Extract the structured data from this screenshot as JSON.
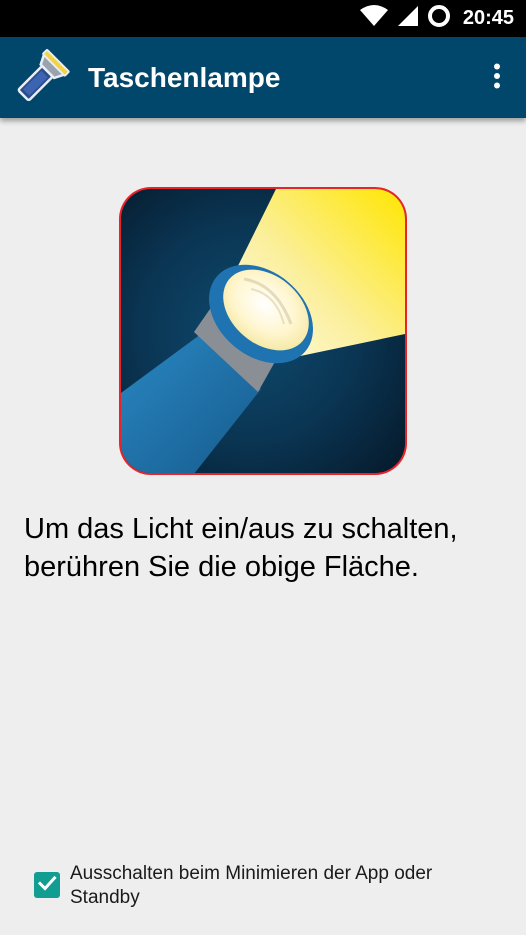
{
  "status_bar": {
    "time": "20:45",
    "icons": [
      "wifi-icon",
      "cell-signal-icon",
      "sync-icon"
    ]
  },
  "app_bar": {
    "title": "Taschenlampe",
    "app_icon": "flashlight-icon",
    "menu_icon": "overflow-menu-icon",
    "color": "#01466b"
  },
  "main": {
    "toggle_icon": "flashlight-toggle-icon",
    "toggle_border_color": "#e8242b",
    "instruction": "Um das Licht ein/aus zu schalten, berühren Sie die obige Fläche."
  },
  "settings": {
    "minimize_checkbox": {
      "label": "Ausschalten beim Minimieren der App oder Standby",
      "checked": true,
      "color": "#129d92"
    }
  }
}
